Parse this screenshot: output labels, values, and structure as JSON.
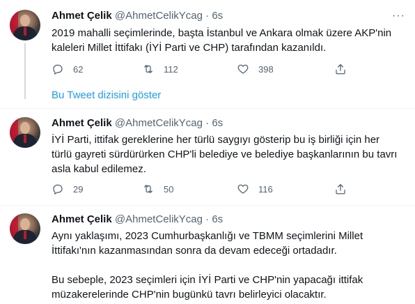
{
  "tweets": [
    {
      "name": "Ahmet Çelik",
      "handle": "@AhmetCelikYcag",
      "separator": "·",
      "time": "6s",
      "text": "2019 mahalli seçimlerinde, başta İstanbul ve Ankara olmak üzere AKP'nin kaleleri Millet İttifakı (İYİ Parti ve CHP) tarafından kazanıldı.",
      "replies": "62",
      "retweets": "112",
      "likes": "398"
    },
    {
      "name": "Ahmet Çelik",
      "handle": "@AhmetCelikYcag",
      "separator": "·",
      "time": "6s",
      "text": "İYİ Parti, ittifak gereklerine her türlü saygıyı gösterip bu iş birliği için her türlü gayreti sürdürürken CHP'li belediye ve belediye başkanlarının bu tavrı asla kabul edilemez.",
      "replies": "29",
      "retweets": "50",
      "likes": "116"
    },
    {
      "name": "Ahmet Çelik",
      "handle": "@AhmetCelikYcag",
      "separator": "·",
      "time": "6s",
      "text": "Aynı yaklaşımı, 2023 Cumhurbaşkanlığı ve TBMM seçimlerini Millet İttifakı'nın kazanmasından sonra da devam edeceği ortadadır.\n\nBu sebeple, 2023 seçimleri için İYİ Parti ve CHP'nin yapacağı ittifak müzakerelerinde CHP'nin bugünkü tavrı belirleyici olacaktır."
    }
  ],
  "show_thread_label": "Bu Tweet dizisini göster",
  "more_label": "···",
  "icons": {
    "reply": "reply-icon",
    "retweet": "retweet-icon",
    "like": "heart-icon",
    "share": "share-icon",
    "more": "more-icon"
  },
  "colors": {
    "link": "#1d9bf0",
    "secondary": "#536471",
    "text": "#0f1419"
  }
}
